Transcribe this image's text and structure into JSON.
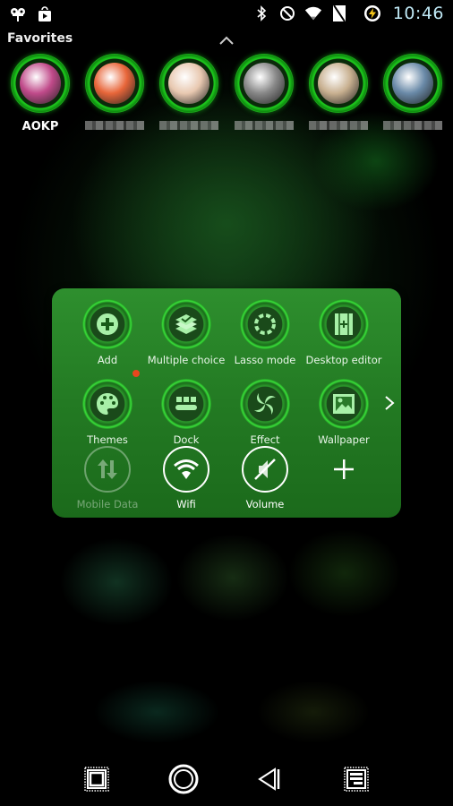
{
  "status_bar": {
    "left_icons": [
      "cyanogen-mascot-icon",
      "play-store-icon"
    ],
    "right_icons": [
      "bluetooth-icon",
      "do-not-disturb-icon",
      "wifi-icon",
      "no-sim-icon",
      "battery-charging-icon"
    ],
    "time": "10:46"
  },
  "favorites": {
    "title": "Favorites",
    "items": [
      {
        "label": "AOKP",
        "blurred": false,
        "color": "#c04a8a"
      },
      {
        "label": "",
        "blurred": true,
        "color": "#e8663a"
      },
      {
        "label": "",
        "blurred": true,
        "color": "#e8c8b0"
      },
      {
        "label": "",
        "blurred": true,
        "color": "#888888"
      },
      {
        "label": "",
        "blurred": true,
        "color": "#c8b090"
      },
      {
        "label": "",
        "blurred": true,
        "color": "#6a8aa8"
      }
    ]
  },
  "panel": {
    "tiles": [
      {
        "label": "Add",
        "icon": "add-icon"
      },
      {
        "label": "Multiple choice",
        "icon": "layers-check-icon"
      },
      {
        "label": "Lasso mode",
        "icon": "lasso-icon"
      },
      {
        "label": "Desktop editor",
        "icon": "desktop-editor-icon"
      },
      {
        "label": "Themes",
        "icon": "palette-icon"
      },
      {
        "label": "Dock",
        "icon": "dock-icon"
      },
      {
        "label": "Effect",
        "icon": "effect-swirl-icon"
      },
      {
        "label": "Wallpaper",
        "icon": "wallpaper-image-icon"
      }
    ],
    "toggles": [
      {
        "label": "Mobile Data",
        "icon": "mobile-data-icon",
        "enabled": false
      },
      {
        "label": "Wifi",
        "icon": "wifi-icon",
        "enabled": true
      },
      {
        "label": "Volume",
        "icon": "volume-muted-icon",
        "enabled": true
      }
    ],
    "add_toggle_icon": "plus-icon",
    "next_page_icon": "chevron-right-icon",
    "notification_dot_color": "#e8461e"
  },
  "nav_bar": {
    "buttons": [
      "recent-apps-icon",
      "home-icon",
      "back-icon",
      "menu-icon"
    ]
  }
}
